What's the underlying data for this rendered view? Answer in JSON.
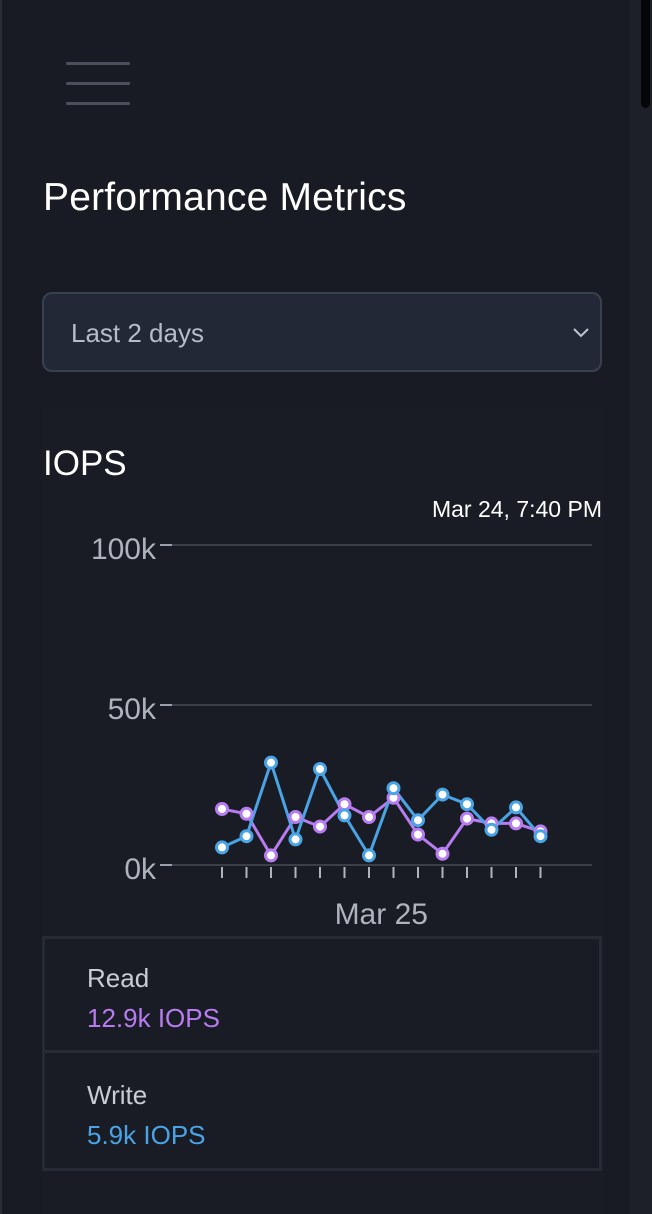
{
  "header": {
    "title": "Performance Metrics"
  },
  "range_select": {
    "value": "Last 2 days"
  },
  "card": {
    "title": "IOPS",
    "timestamp": "Mar 24, 7:40 PM"
  },
  "colors": {
    "read": "#b77cf0",
    "write": "#4aa3e4",
    "background": "#181b23"
  },
  "legend": [
    {
      "label": "Read",
      "value": "12.9k IOPS"
    },
    {
      "label": "Write",
      "value": "5.9k IOPS"
    }
  ],
  "chart_data": {
    "type": "line",
    "title": "IOPS",
    "ylim": [
      0,
      100000
    ],
    "yticks": [
      "100k",
      "50k",
      "0k"
    ],
    "xtick_label": "Mar 25",
    "grid": true,
    "series": [
      {
        "name": "Read",
        "values": [
          17500,
          16000,
          3000,
          15000,
          12000,
          19000,
          15000,
          21000,
          9500,
          3500,
          14500,
          13000,
          13000,
          10500
        ]
      },
      {
        "name": "Write",
        "values": [
          5500,
          9000,
          32000,
          8000,
          30000,
          15500,
          3000,
          24000,
          14000,
          22000,
          19000,
          11000,
          18000,
          9000
        ]
      }
    ]
  }
}
